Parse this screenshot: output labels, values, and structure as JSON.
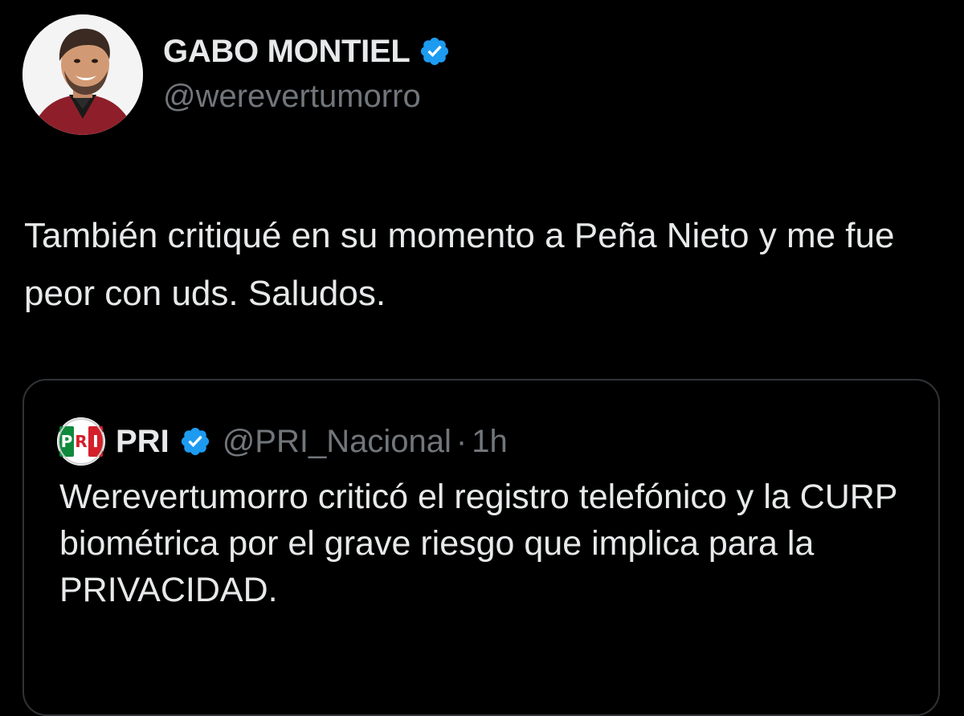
{
  "tweet": {
    "author": {
      "display_name": "GABO MONTIEL",
      "handle": "@werevertumorro",
      "verified": true,
      "avatar_icon": "user-avatar-photo"
    },
    "text": "También critiqué en su momento a Peña Nieto y me fue peor con uds. Saludos."
  },
  "quoted_tweet": {
    "author": {
      "display_name": "PRI",
      "handle": "@PRI_Nacional",
      "verified": true,
      "logo_icon": "pri-party-logo"
    },
    "separator": "·",
    "time": "1h",
    "text": "Werevertumorro criticó el registro telefónico y la CURP biométrica por el grave riesgo que implica para la PRIVACIDAD."
  },
  "colors": {
    "background": "#000000",
    "primary_text": "#e7e9ea",
    "secondary_text": "#71767b",
    "verified_blue": "#1d9bf0",
    "card_border": "#2f3336"
  }
}
